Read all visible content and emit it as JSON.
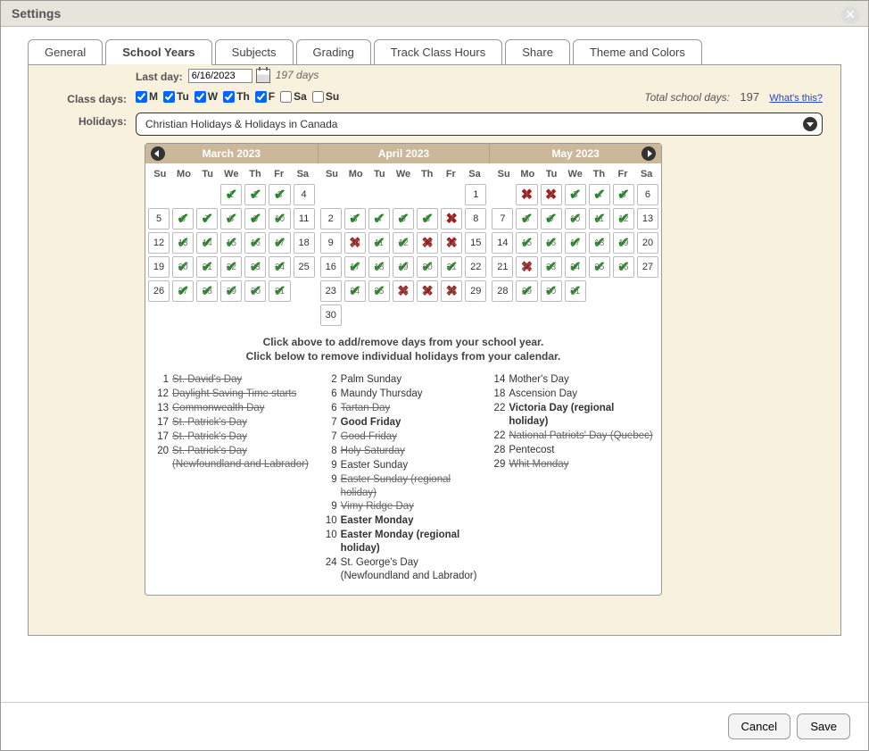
{
  "modalTitle": "Settings",
  "tabs": [
    "General",
    "School Years",
    "Subjects",
    "Grading",
    "Track Class Hours",
    "Share",
    "Theme and Colors"
  ],
  "activeTab": 1,
  "lastDayLabel": "Last day:",
  "lastDayValue": "6/16/2023",
  "lastDayDays": "197 days",
  "classDaysLabel": "Class days:",
  "days": [
    {
      "abbr": "M",
      "checked": true
    },
    {
      "abbr": "Tu",
      "checked": true
    },
    {
      "abbr": "W",
      "checked": true
    },
    {
      "abbr": "Th",
      "checked": true
    },
    {
      "abbr": "F",
      "checked": true
    },
    {
      "abbr": "Sa",
      "checked": false
    },
    {
      "abbr": "Su",
      "checked": false
    }
  ],
  "totalLabel": "Total school days:",
  "totalValue": "197",
  "whatsThis": "What's this?",
  "holidaysLabel": "Holidays:",
  "holidaysValue": "Christian Holidays & Holidays in Canada",
  "dow": [
    "Su",
    "Mo",
    "Tu",
    "We",
    "Th",
    "Fr",
    "Sa"
  ],
  "months": [
    {
      "title": "March 2023",
      "navLeft": true,
      "cells": [
        {
          "t": "e"
        },
        {
          "t": "e"
        },
        {
          "t": "e"
        },
        {
          "t": "c",
          "n": 1
        },
        {
          "t": "c",
          "n": 2
        },
        {
          "t": "c",
          "n": 3
        },
        {
          "t": "n",
          "n": 4
        },
        {
          "t": "n",
          "n": 5
        },
        {
          "t": "c",
          "n": 6
        },
        {
          "t": "c",
          "n": 7
        },
        {
          "t": "c",
          "n": 8
        },
        {
          "t": "c",
          "n": 9
        },
        {
          "t": "c",
          "n": 10
        },
        {
          "t": "n",
          "n": 11
        },
        {
          "t": "n",
          "n": 12
        },
        {
          "t": "c",
          "n": 13
        },
        {
          "t": "c",
          "n": 14
        },
        {
          "t": "c",
          "n": 15
        },
        {
          "t": "c",
          "n": 16
        },
        {
          "t": "c",
          "n": 17
        },
        {
          "t": "n",
          "n": 18
        },
        {
          "t": "n",
          "n": 19
        },
        {
          "t": "c",
          "n": 20
        },
        {
          "t": "c",
          "n": 21
        },
        {
          "t": "c",
          "n": 22
        },
        {
          "t": "c",
          "n": 23
        },
        {
          "t": "c",
          "n": 24
        },
        {
          "t": "n",
          "n": 25
        },
        {
          "t": "n",
          "n": 26
        },
        {
          "t": "c",
          "n": 27
        },
        {
          "t": "c",
          "n": 28
        },
        {
          "t": "c",
          "n": 29
        },
        {
          "t": "c",
          "n": 30
        },
        {
          "t": "c",
          "n": 31
        },
        {
          "t": "e"
        }
      ]
    },
    {
      "title": "April 2023",
      "cells": [
        {
          "t": "e"
        },
        {
          "t": "e"
        },
        {
          "t": "e"
        },
        {
          "t": "e"
        },
        {
          "t": "e"
        },
        {
          "t": "e"
        },
        {
          "t": "n",
          "n": 1
        },
        {
          "t": "n",
          "n": 2
        },
        {
          "t": "c",
          "n": 3
        },
        {
          "t": "c",
          "n": 4
        },
        {
          "t": "c",
          "n": 5
        },
        {
          "t": "c",
          "n": 6
        },
        {
          "t": "x",
          "n": 7
        },
        {
          "t": "n",
          "n": 8
        },
        {
          "t": "n",
          "n": 9
        },
        {
          "t": "x",
          "n": 10
        },
        {
          "t": "c",
          "n": 11
        },
        {
          "t": "c",
          "n": 12
        },
        {
          "t": "x",
          "n": 13
        },
        {
          "t": "x",
          "n": 14
        },
        {
          "t": "n",
          "n": 15
        },
        {
          "t": "n",
          "n": 16
        },
        {
          "t": "c",
          "n": 17
        },
        {
          "t": "c",
          "n": 18
        },
        {
          "t": "c",
          "n": 19
        },
        {
          "t": "c",
          "n": 20
        },
        {
          "t": "c",
          "n": 21
        },
        {
          "t": "n",
          "n": 22
        },
        {
          "t": "n",
          "n": 23
        },
        {
          "t": "c",
          "n": 24
        },
        {
          "t": "c",
          "n": 25
        },
        {
          "t": "x",
          "n": 26
        },
        {
          "t": "x",
          "n": 27
        },
        {
          "t": "x",
          "n": 28
        },
        {
          "t": "n",
          "n": 29
        },
        {
          "t": "n",
          "n": 30
        },
        {
          "t": "e"
        },
        {
          "t": "e"
        },
        {
          "t": "e"
        },
        {
          "t": "e"
        },
        {
          "t": "e"
        },
        {
          "t": "e"
        }
      ]
    },
    {
      "title": "May 2023",
      "navRight": true,
      "cells": [
        {
          "t": "e"
        },
        {
          "t": "x",
          "n": 1
        },
        {
          "t": "x",
          "n": 2
        },
        {
          "t": "c",
          "n": 3
        },
        {
          "t": "c",
          "n": 4
        },
        {
          "t": "c",
          "n": 5
        },
        {
          "t": "n",
          "n": 6
        },
        {
          "t": "n",
          "n": 7
        },
        {
          "t": "c",
          "n": 8
        },
        {
          "t": "c",
          "n": 9
        },
        {
          "t": "c",
          "n": 10
        },
        {
          "t": "c",
          "n": 11
        },
        {
          "t": "c",
          "n": 12
        },
        {
          "t": "n",
          "n": 13
        },
        {
          "t": "n",
          "n": 14
        },
        {
          "t": "c",
          "n": 15
        },
        {
          "t": "c",
          "n": 16
        },
        {
          "t": "c",
          "n": 17
        },
        {
          "t": "c",
          "n": 18
        },
        {
          "t": "c",
          "n": 19
        },
        {
          "t": "n",
          "n": 20
        },
        {
          "t": "n",
          "n": 21
        },
        {
          "t": "x",
          "n": 22
        },
        {
          "t": "c",
          "n": 23
        },
        {
          "t": "c",
          "n": 24
        },
        {
          "t": "c",
          "n": 25
        },
        {
          "t": "c",
          "n": 26
        },
        {
          "t": "n",
          "n": 27
        },
        {
          "t": "n",
          "n": 28
        },
        {
          "t": "c",
          "n": 29
        },
        {
          "t": "c",
          "n": 30
        },
        {
          "t": "c",
          "n": 31
        },
        {
          "t": "e"
        },
        {
          "t": "e"
        },
        {
          "t": "e"
        }
      ]
    }
  ],
  "instr1": "Click above to add/remove days from your school year.",
  "instr2": "Click below to remove individual holidays from your calendar.",
  "holidayCols": [
    [
      {
        "d": 1,
        "n": "St. David's Day",
        "s": true
      },
      {
        "d": 12,
        "n": "Daylight Saving Time starts",
        "s": true
      },
      {
        "d": 13,
        "n": "Commonwealth Day",
        "s": true
      },
      {
        "d": 17,
        "n": "St. Patrick's Day",
        "s": true
      },
      {
        "d": 17,
        "n": "St. Patrick's Day",
        "s": true
      },
      {
        "d": 20,
        "n": "St. Patrick's Day (Newfoundland and Labrador)",
        "s": true
      }
    ],
    [
      {
        "d": 2,
        "n": "Palm Sunday"
      },
      {
        "d": 6,
        "n": "Maundy Thursday"
      },
      {
        "d": 6,
        "n": "Tartan Day",
        "s": true
      },
      {
        "d": 7,
        "n": "Good Friday",
        "b": true
      },
      {
        "d": 7,
        "n": "Good Friday",
        "s": true
      },
      {
        "d": 8,
        "n": "Holy Saturday",
        "s": true
      },
      {
        "d": 9,
        "n": "Easter Sunday"
      },
      {
        "d": 9,
        "n": "Easter Sunday (regional holiday)",
        "s": true
      },
      {
        "d": 9,
        "n": "Vimy Ridge Day",
        "s": true
      },
      {
        "d": 10,
        "n": "Easter Monday",
        "b": true
      },
      {
        "d": 10,
        "n": "Easter Monday (regional holiday)",
        "b": true
      },
      {
        "d": 24,
        "n": "St. George's Day (Newfoundland and Labrador)"
      }
    ],
    [
      {
        "d": 14,
        "n": "Mother's Day"
      },
      {
        "d": 18,
        "n": "Ascension Day"
      },
      {
        "d": 22,
        "n": "Victoria Day (regional holiday)",
        "b": true
      },
      {
        "d": 22,
        "n": "National Patriots' Day (Quebec)",
        "s": true
      },
      {
        "d": 28,
        "n": "Pentecost"
      },
      {
        "d": 29,
        "n": "Whit Monday",
        "s": true
      }
    ]
  ],
  "cancel": "Cancel",
  "save": "Save"
}
